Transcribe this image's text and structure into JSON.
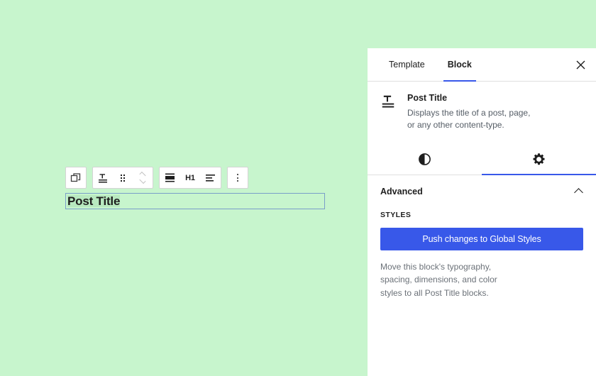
{
  "canvas": {
    "background_color": "#c7f5cd",
    "title_block": {
      "name": "post-title-block",
      "text": "Post Title",
      "selected_border_color": "#7a9ec9"
    },
    "toolbar": {
      "groups": [
        {
          "name": "block-switcher-group",
          "buttons": [
            {
              "icon": "copy-blocks-icon",
              "label": "",
              "title": "Select parent block"
            }
          ]
        },
        {
          "name": "block-movers-group",
          "buttons": [
            {
              "icon": "post-title-block-icon",
              "label": "",
              "title": "Post Title"
            },
            {
              "icon": "drag-handle-icon",
              "label": "",
              "title": "Drag"
            },
            {
              "icon": "move-up-down-icon",
              "label": "",
              "title": "Move up or down"
            }
          ]
        },
        {
          "name": "block-format-group",
          "buttons": [
            {
              "icon": "vertical-align-center-icon",
              "label": "",
              "title": "Change vertical alignment"
            },
            {
              "icon": "heading-level-icon",
              "label": "H1",
              "title": "Change heading level"
            },
            {
              "icon": "text-align-icon",
              "label": "",
              "title": "Align text"
            }
          ]
        },
        {
          "name": "block-options-group",
          "buttons": [
            {
              "icon": "more-vertical-icon",
              "label": "",
              "title": "Options"
            }
          ]
        }
      ]
    }
  },
  "sidebar": {
    "accent_color": "#3858e9",
    "tabs": [
      {
        "label": "Template",
        "active": false
      },
      {
        "label": "Block",
        "active": true
      }
    ],
    "close_button": {
      "icon": "close-icon",
      "label": "✕"
    },
    "block_info": {
      "icon": "post-title-block-icon",
      "title": "Post Title",
      "description": "Displays the title of a post, page, or any other content-type."
    },
    "icon_tabs": [
      {
        "name": "styles-tab",
        "icon": "contrast-half-circle-icon",
        "active": false
      },
      {
        "name": "settings-tab",
        "icon": "gear-icon",
        "active": true
      }
    ],
    "advanced": {
      "header_label": "Advanced",
      "expanded": true,
      "collapse_icon": "chevron-up-icon",
      "section_label": "STYLES",
      "push_button_label": "Push changes to Global Styles",
      "help_text": "Move this block's typography, spacing, dimensions, and color styles to all Post Title blocks."
    }
  }
}
